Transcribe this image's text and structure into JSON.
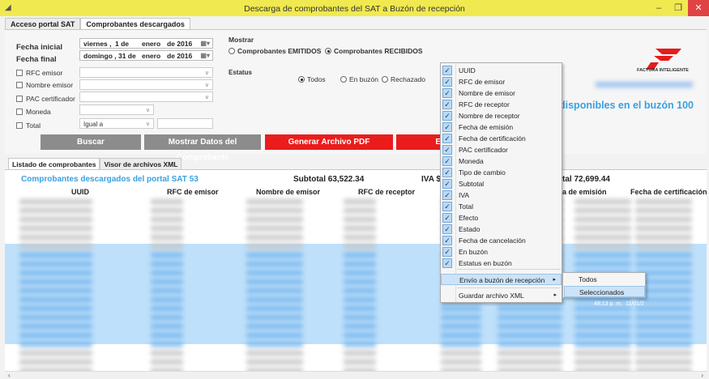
{
  "window": {
    "title": "Descarga de comprobantes del SAT a Buzón de recepción",
    "minimize": "–",
    "maximize": "❐",
    "close": "✕"
  },
  "top_tabs": [
    {
      "label": "Acceso portal SAT"
    },
    {
      "label": "Comprobantes descargados"
    }
  ],
  "filters": {
    "fecha_inicial_label": "Fecha inicial",
    "fecha_final_label": "Fecha final",
    "fecha_inicial": {
      "weekday": "viernes ,",
      "day": "1 de",
      "month": "enero",
      "year": "de 2016"
    },
    "fecha_final": {
      "weekday": "domingo , 31 de",
      "month": "enero",
      "year": "de 2016"
    },
    "rfc_emisor_label": "RFC emisor",
    "nombre_emisor_label": "Nombre emisor",
    "pac_label": "PAC certificador",
    "moneda_label": "Moneda",
    "total_label": "Total",
    "total_operator": "Igual a"
  },
  "mostrar": {
    "label": "Mostrar",
    "emitidos": "Comprobantes EMITIDOS",
    "recibidos": "Comprobantes RECIBIDOS",
    "selected": "recibidos"
  },
  "estatus": {
    "label": "Estatus",
    "todos": "Todos",
    "en_buzon": "En buzón",
    "rechazado": "Rechazado",
    "selected": "todos"
  },
  "buttons": {
    "buscar": "Buscar",
    "mostrar_datos": "Mostrar Datos del Comprobante",
    "generar_pdf": "Generar Archivo PDF",
    "partial_red": "E"
  },
  "brand": {
    "logo_text": "FACTURA INTELIGENTE"
  },
  "availability": {
    "text": "disponibles en el buzón 100"
  },
  "bottom_tabs": [
    {
      "label": "Listado de comprobantes"
    },
    {
      "label": "Visor de archivos XML"
    }
  ],
  "summary": {
    "descargados": "Comprobantes descargados del portal SAT 53",
    "subtotal": "Subtotal 63,522.34",
    "iva": "IVA $",
    "total": "tal 72,699.44"
  },
  "columns": [
    "UUID",
    "RFC de emisor",
    "Nombre de emisor",
    "RFC de receptor",
    "a de emisión",
    "Fecha de certificación"
  ],
  "visible_cell_fragments": {
    "time": "48:13 p. m.",
    "date": "11/01/2"
  },
  "context_menu": {
    "checked_items": [
      "UUID",
      "RFC de emisor",
      "Nombre de emisor",
      "RFC de receptor",
      "Nombre de receptor",
      "Fecha de emisión",
      "Fecha de certificación",
      "PAC certificador",
      "Moneda",
      "Tipo de cambio",
      "Subtotal",
      "IVA",
      "Total",
      "Efecto",
      "Estado",
      "Fecha de cancelación",
      "En buzón",
      "Estatus en buzón"
    ],
    "envio": "Envío a buzón de recepción",
    "guardar": "Guardar archivo XML"
  },
  "submenu": {
    "todos": "Todos",
    "seleccionados": "Seleccionados"
  },
  "colors": {
    "titlebar": "#f0e94f",
    "accent_blue": "#3aa0e0",
    "red_button": "#ea1c1c",
    "gray_button": "#8c8c8c",
    "selection": "#bfe0fa"
  }
}
